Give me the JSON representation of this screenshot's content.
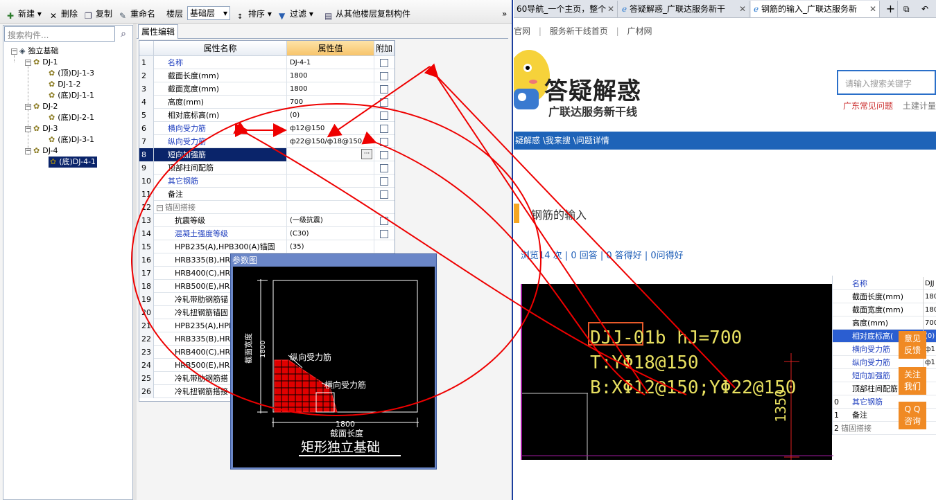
{
  "toolbar": {
    "new": "新建",
    "delete": "删除",
    "copy": "复制",
    "rename": "重命名",
    "floor_label": "楼层",
    "floor_value": "基础层",
    "sort": "排序",
    "filter": "过滤",
    "copy_from_floor": "从其他楼层复制构件",
    "more": "»"
  },
  "tree": {
    "search_placeholder": "搜索构件...",
    "root": "独立基础",
    "nodes": [
      {
        "label": "DJ-1",
        "level": 1
      },
      {
        "label": "(顶)DJ-1-3",
        "level": 2
      },
      {
        "label": "DJ-1-2",
        "level": 2
      },
      {
        "label": "(底)DJ-1-1",
        "level": 2
      },
      {
        "label": "DJ-2",
        "level": 1
      },
      {
        "label": "(底)DJ-2-1",
        "level": 2
      },
      {
        "label": "DJ-3",
        "level": 1
      },
      {
        "label": "(底)DJ-3-1",
        "level": 2
      },
      {
        "label": "DJ-4",
        "level": 1
      },
      {
        "label": "(底)DJ-4-1",
        "level": 2,
        "selected": true
      }
    ]
  },
  "props": {
    "tab": "属性编辑",
    "headers": {
      "name": "属性名称",
      "value": "属性值",
      "extra": "附加"
    },
    "rows": [
      {
        "n": "1",
        "name": "名称",
        "value": "DJ-4-1",
        "blue": true,
        "chk": false
      },
      {
        "n": "2",
        "name": "截面长度(mm)",
        "value": "1800",
        "chk": true
      },
      {
        "n": "3",
        "name": "截面宽度(mm)",
        "value": "1800",
        "chk": true
      },
      {
        "n": "4",
        "name": "高度(mm)",
        "value": "700",
        "chk": true
      },
      {
        "n": "5",
        "name": "相对底标高(m)",
        "value": "(0)",
        "chk": true
      },
      {
        "n": "6",
        "name": "横向受力筋",
        "value": "ф12@150",
        "blue": true,
        "chk": true
      },
      {
        "n": "7",
        "name": "纵向受力筋",
        "value": "ф22@150/ф18@150",
        "blue": true,
        "chk": true
      },
      {
        "n": "8",
        "name": "短向加强筋",
        "value": "",
        "blue": true,
        "chk": true,
        "selected": true
      },
      {
        "n": "9",
        "name": "顶部柱间配筋",
        "value": "",
        "chk": true
      },
      {
        "n": "10",
        "name": "其它钢筋",
        "value": "",
        "blue": true,
        "chk": false
      },
      {
        "n": "11",
        "name": "备注",
        "value": "",
        "chk": true
      },
      {
        "n": "12",
        "name": "锚固搭接",
        "value": "",
        "group": true
      },
      {
        "n": "13",
        "name": "抗震等级",
        "value": "(一级抗震)",
        "sub": true,
        "chk": true
      },
      {
        "n": "14",
        "name": "混凝土强度等级",
        "value": "(C30)",
        "sub": true,
        "blue": true,
        "chk": true
      },
      {
        "n": "15",
        "name": "HPB235(A),HPB300(A)锚固",
        "value": "(35)",
        "sub": true
      },
      {
        "n": "16",
        "name": "HRB335(B),HRB",
        "value": "",
        "sub": true
      },
      {
        "n": "17",
        "name": "HRB400(C),HRB",
        "value": "",
        "sub": true
      },
      {
        "n": "18",
        "name": "HRB500(E),HRB",
        "value": "",
        "sub": true
      },
      {
        "n": "19",
        "name": "冷轧带肋钢筋锚",
        "value": "",
        "sub": true
      },
      {
        "n": "20",
        "name": "冷轧扭钢筋锚固",
        "value": "",
        "sub": true
      },
      {
        "n": "21",
        "name": "HPB235(A),HPB",
        "value": "",
        "sub": true
      },
      {
        "n": "22",
        "name": "HRB335(B),HRB",
        "value": "",
        "sub": true
      },
      {
        "n": "23",
        "name": "HRB400(C),HRB",
        "value": "",
        "sub": true
      },
      {
        "n": "24",
        "name": "HRB500(E),HRB",
        "value": "",
        "sub": true
      },
      {
        "n": "25",
        "name": "冷轧带肋钢筋搭",
        "value": "",
        "sub": true
      },
      {
        "n": "26",
        "name": "冷轧扭钢筋搭接",
        "value": "",
        "sub": true
      }
    ]
  },
  "diagram": {
    "title": "参数图",
    "width_label": "截面宽度",
    "width_value": "1800",
    "length_value": "1800",
    "length_label": "截面长度",
    "long_bar": "纵向受力筋",
    "trans_bar": "横向受力筋",
    "caption": "矩形独立基础"
  },
  "browser": {
    "tabs": [
      {
        "label": "60导航_一个主页，整个",
        "active": false
      },
      {
        "label": "答疑解惑_广联达服务新干",
        "active": false
      },
      {
        "label": "钢筋的输入_广联达服务新",
        "active": true
      }
    ],
    "nav": [
      "官网",
      "服务新干线首页",
      "广材网"
    ],
    "logo_title": "答疑解惑",
    "logo_sub": "广联达服务新干线",
    "search_placeholder": "请输入搜索关键字",
    "hot_links": [
      "广东常见问题",
      "土建计量"
    ],
    "breadcrumb": "疑解惑 \\我来搜 \\问题详情",
    "question_title": "钢筋的输入",
    "stats": "浏览14 次 | 0 回答 | 0 答得好 | 0问得好",
    "cad": {
      "line1": "DJJ-01b   hJ=700",
      "line2": "T:YΦ18@150",
      "line3": "B:XΦ12@150;YΦ22@150",
      "dim": "1350"
    },
    "mini_rows": [
      {
        "n": "",
        "name": "名称",
        "v": "DJJ"
      },
      {
        "n": "",
        "name": "截面长度(mm)",
        "v": "180"
      },
      {
        "n": "",
        "name": "截面宽度(mm)",
        "v": "180"
      },
      {
        "n": "",
        "name": "高度(mm)",
        "v": "700"
      },
      {
        "n": "",
        "name": "相对底标高(",
        "v": "(0)",
        "hl": true
      },
      {
        "n": "",
        "name": "横向受力筋",
        "v": "ф1"
      },
      {
        "n": "",
        "name": "纵向受力筋",
        "v": "ф1"
      },
      {
        "n": "",
        "name": "短向加强筋",
        "v": ""
      },
      {
        "n": "",
        "name": "顶部柱间配筋",
        "v": ""
      },
      {
        "n": "0",
        "name": "其它钢筋",
        "v": ""
      },
      {
        "n": "1",
        "name": "备注",
        "v": ""
      },
      {
        "n": "2",
        "name": "锚固搭接",
        "v": "",
        "group": true
      }
    ],
    "float_buttons": [
      {
        "l1": "意见",
        "l2": "反馈"
      },
      {
        "l1": "关注",
        "l2": "我们"
      },
      {
        "l1": "Q Q",
        "l2": "咨询"
      }
    ]
  }
}
